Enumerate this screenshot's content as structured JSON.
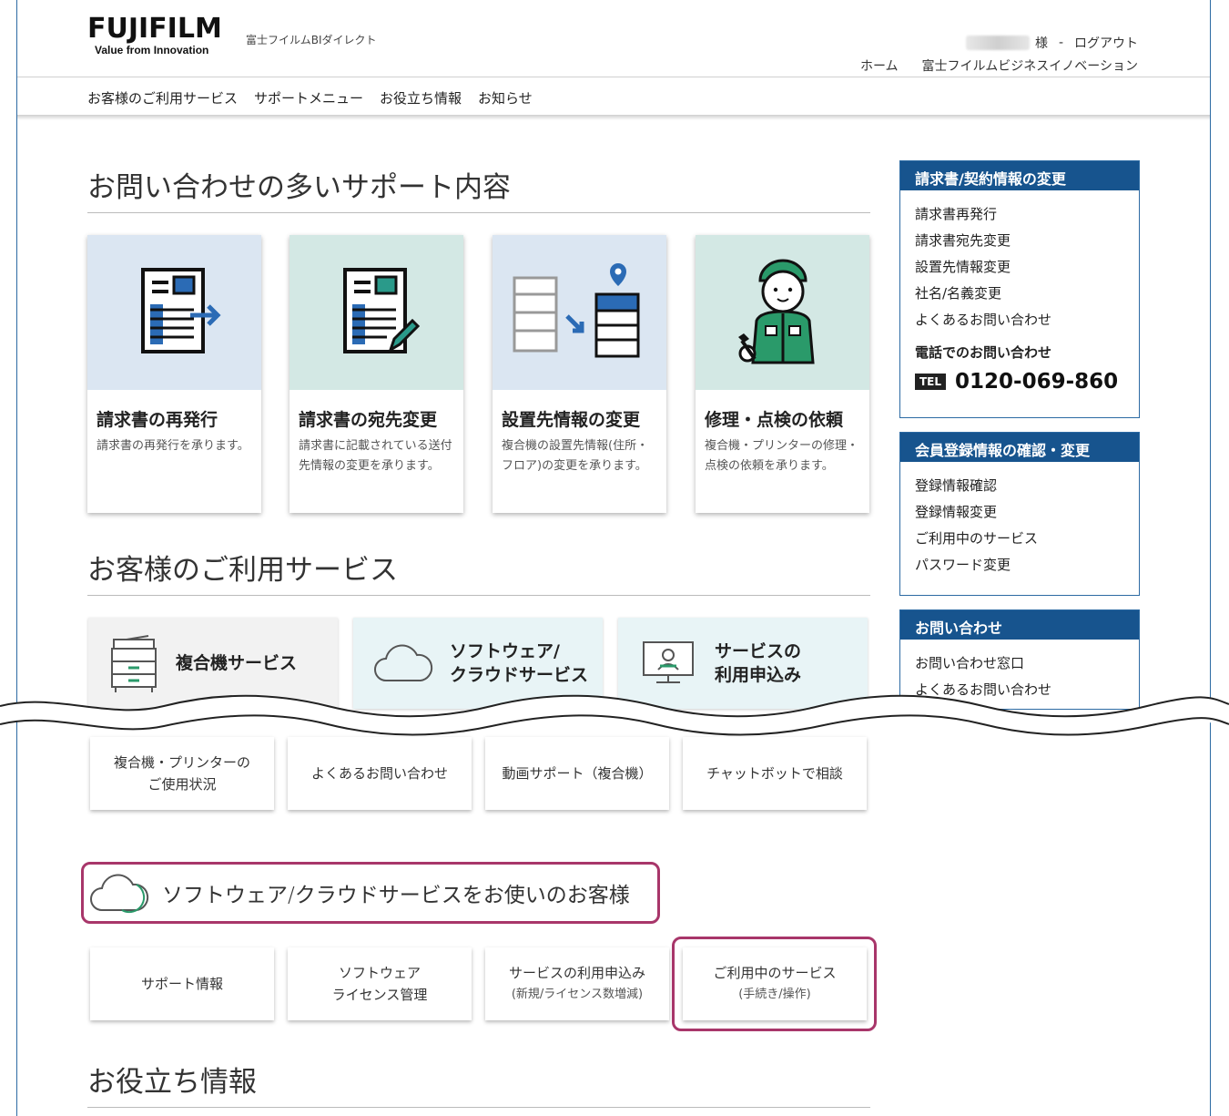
{
  "header": {
    "logo_main": "FUJIFILM",
    "logo_sub": "Value from Innovation",
    "brand_sub": "富士フイルムBIダイレクト",
    "user_suffix": "様",
    "separator": "-",
    "logout": "ログアウト",
    "home": "ホーム",
    "company": "富士フイルムビジネスイノベーション"
  },
  "nav": {
    "items": [
      "お客様のご利用サービス",
      "サポートメニュー",
      "お役立ち情報",
      "お知らせ"
    ]
  },
  "sections": {
    "support": "お問い合わせの多いサポート内容",
    "services": "お客様のご利用サービス",
    "useful": "お役立ち情報"
  },
  "cards": [
    {
      "title": "請求書の再発行",
      "desc": "請求書の再発行を承ります。",
      "bg": "#dbe6f2",
      "icon": "invoice-arrow-icon"
    },
    {
      "title": "請求書の宛先変更",
      "desc": "請求書に記載されている送付先情報の変更を承ります。",
      "bg": "#d3e8e4",
      "icon": "invoice-pen-icon"
    },
    {
      "title": "設置先情報の変更",
      "desc": "複合機の設置先情報(住所・フロア)の変更を承ります。",
      "bg": "#dbe6f2",
      "icon": "printer-move-icon"
    },
    {
      "title": "修理・点検の依頼",
      "desc": "複合機・プリンターの修理・点検の依頼を承ります。",
      "bg": "#d3e8e4",
      "icon": "technician-icon"
    }
  ],
  "service_tiles": [
    {
      "label": "複合機サービス",
      "bg": "#f2f2f2",
      "icon": "mfp-icon"
    },
    {
      "label_line1": "ソフトウェア/",
      "label_line2": "クラウドサービス",
      "bg": "#e8f4f6",
      "icon": "cloud-icon"
    },
    {
      "label_line1": "サービスの",
      "label_line2": "利用申込み",
      "bg": "#e8f4f6",
      "icon": "monitor-user-icon"
    }
  ],
  "sidebar": {
    "invoice": {
      "title": "請求書/契約情報の変更",
      "items": [
        "請求書再発行",
        "請求書宛先変更",
        "設置先情報変更",
        "社名/名義変更",
        "よくあるお問い合わせ"
      ],
      "phone_label": "電話でのお問い合わせ",
      "tel_badge": "TEL",
      "tel_number": "0120-069-860"
    },
    "member": {
      "title": "会員登録情報の確認・変更",
      "items": [
        "登録情報確認",
        "登録情報変更",
        "ご利用中のサービス",
        "パスワード変更"
      ]
    },
    "contact": {
      "title": "お問い合わせ",
      "items": [
        "お問い合わせ窓口",
        "よくあるお問い合わせ"
      ]
    }
  },
  "mfp_buttons": [
    {
      "line1": "複合機・プリンターの",
      "line2": "ご使用状況"
    },
    {
      "line1": "よくあるお問い合わせ"
    },
    {
      "line1": "動画サポート（複合機）"
    },
    {
      "line1": "チャットボットで相談"
    }
  ],
  "cloud_banner": "ソフトウェア/クラウドサービスをお使いのお客様",
  "cloud_buttons": [
    {
      "line1": "サポート情報"
    },
    {
      "line1": "ソフトウェア",
      "line2": "ライセンス管理"
    },
    {
      "line1": "サービスの利用申込み",
      "sub": "(新規/ライセンス数増減)"
    },
    {
      "line1": "ご利用中のサービス",
      "sub": "(手続き/操作)"
    }
  ],
  "colors": {
    "accent_blue": "#17548e",
    "highlight": "#a8366a",
    "green": "#2a9a6a"
  }
}
